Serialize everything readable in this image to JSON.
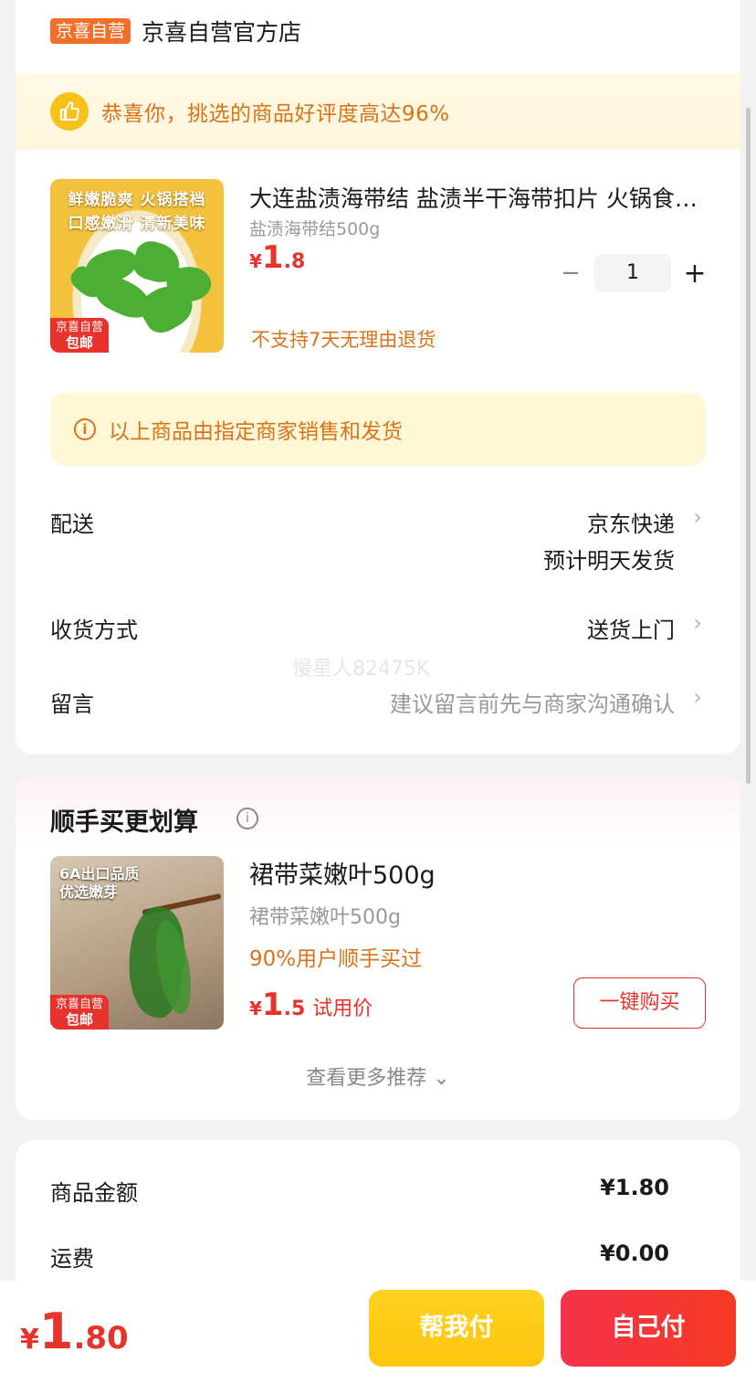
{
  "store": {
    "badge": "京喜自营",
    "name": "京喜自营官方店"
  },
  "praise": {
    "text": "恭喜你，挑选的商品好评度高达96%",
    "icon": "thumbs-up-icon"
  },
  "product": {
    "image_caption_line1": "鲜嫩脆爽 火锅搭档",
    "image_caption_line2": "口感嫩滑 清新美味",
    "image_tag_line1": "京喜自营",
    "image_tag_line2": "包邮",
    "title": "大连盐渍海带结 盐渍半干海带扣片 火锅食材凉拌菜",
    "spec": "盐渍海带结500g",
    "price_currency": "¥",
    "price_int": "1",
    "price_dec": ".8",
    "quantity": "1",
    "minus": "−",
    "plus": "+",
    "return_policy": "不支持7天无理由退货"
  },
  "notice": {
    "icon_glyph": "i",
    "text": "以上商品由指定商家销售和发货"
  },
  "delivery": {
    "label": "配送",
    "value_line1": "京东快递",
    "value_line2": "预计明天发货",
    "chevron": "›"
  },
  "receive": {
    "label": "收货方式",
    "value": "送货上门",
    "chevron": "›"
  },
  "message": {
    "label": "留言",
    "placeholder": "建议留言前先与商家沟通确认",
    "chevron": "›"
  },
  "watermark": "慢星人82475K",
  "recommend": {
    "title": "顺手买更划算",
    "info_glyph": "i",
    "image_caption_line1": "6A出口品质",
    "image_caption_line2": "优选嫩芽",
    "image_tag_line1": "京喜自营",
    "image_tag_line2": "包邮",
    "item_title": "裙带菜嫩叶500g",
    "item_spec": "裙带菜嫩叶500g",
    "bought_text": "90%用户顺手买过",
    "price_currency": "¥",
    "price_int": "1",
    "price_dec": ".5",
    "price_note": "试用价",
    "buy_button": "一键购买",
    "more_link": "查看更多推荐 ⌄"
  },
  "summary": {
    "rows": [
      {
        "label": "商品金额",
        "value": "¥1.80"
      },
      {
        "label": "运费",
        "value": "¥0.00"
      }
    ]
  },
  "footer": {
    "total_currency": "¥",
    "total_int": "1",
    "total_dec": ".80",
    "help_pay": "帮我付",
    "self_pay": "自己付"
  },
  "colors": {
    "accent_red": "#e8322c",
    "accent_orange": "#d9731a",
    "yellow": "#ffc40d"
  }
}
